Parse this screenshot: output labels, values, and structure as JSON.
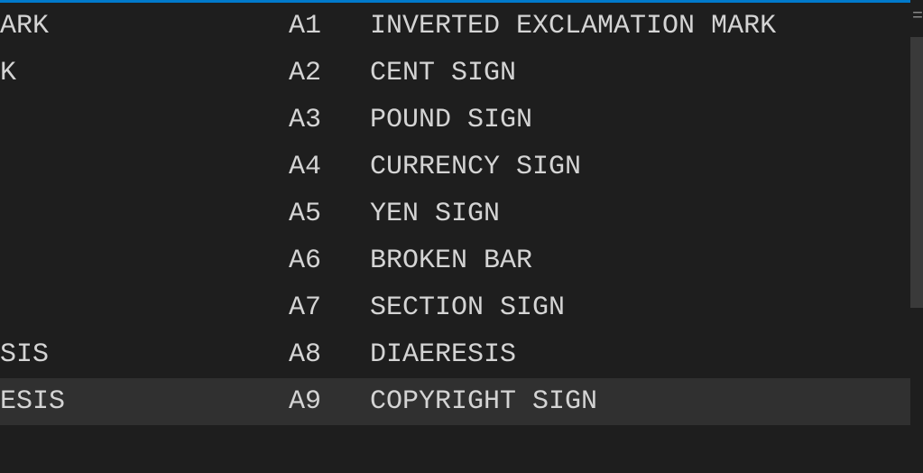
{
  "colors": {
    "bg": "#1e1e1e",
    "fg": "#d4d4d4",
    "accent": "#007acc",
    "selection": "#303030"
  },
  "rows": [
    {
      "leftFragment": "ARK",
      "code": "A1",
      "name": "INVERTED EXCLAMATION MARK",
      "selected": false
    },
    {
      "leftFragment": "K",
      "code": "A2",
      "name": "CENT SIGN",
      "selected": false
    },
    {
      "leftFragment": "",
      "code": "A3",
      "name": "POUND SIGN",
      "selected": false
    },
    {
      "leftFragment": "",
      "code": "A4",
      "name": "CURRENCY SIGN",
      "selected": false
    },
    {
      "leftFragment": "",
      "code": "A5",
      "name": "YEN SIGN",
      "selected": false
    },
    {
      "leftFragment": "",
      "code": "A6",
      "name": "BROKEN BAR",
      "selected": false
    },
    {
      "leftFragment": "",
      "code": "A7",
      "name": "SECTION SIGN",
      "selected": false
    },
    {
      "leftFragment": "SIS",
      "code": "A8",
      "name": "DIAERESIS",
      "selected": false
    },
    {
      "leftFragment": "ESIS",
      "code": "A9",
      "name": "COPYRIGHT SIGN",
      "selected": true
    }
  ]
}
